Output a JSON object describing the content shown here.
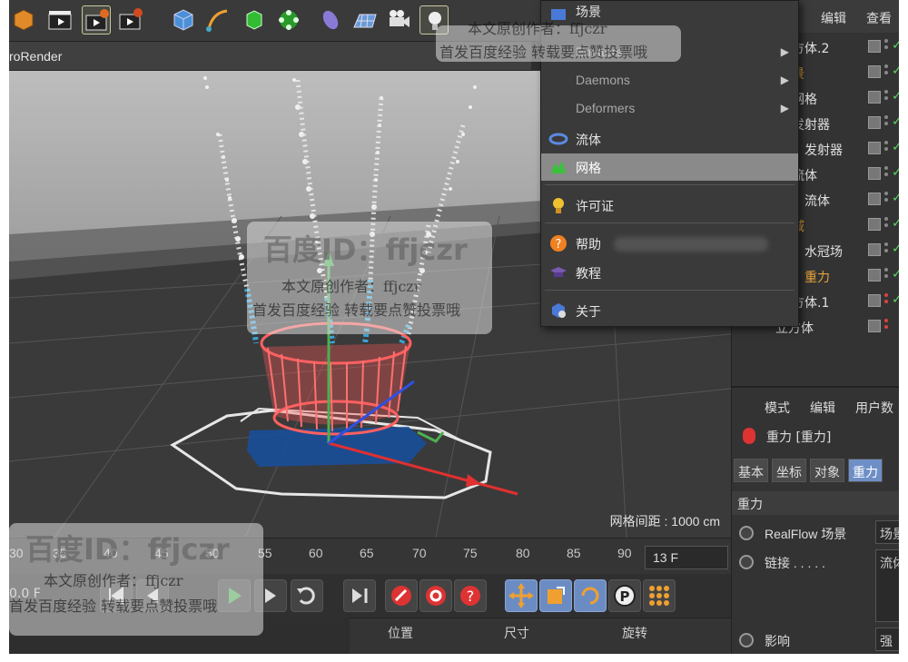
{
  "app": {
    "viewport_title": "roRender",
    "grid_distance": "网格间距 : 1000 cm"
  },
  "toolbar": {
    "icons": [
      "cube-orange-icon",
      "clapperboard-icon",
      "render-view-icon",
      "render-settings-icon",
      "cube-primitive-icon",
      "pen-spline-icon",
      "subdivision-icon",
      "array-generator-icon",
      "deformer-icon",
      "floor-icon",
      "camera-icon",
      "light-icon"
    ]
  },
  "menu": {
    "items": [
      {
        "label": "场景",
        "icon": "scene-icon"
      },
      {
        "label": "Emitters",
        "submenu": true,
        "dim": true
      },
      {
        "label": "Daemons",
        "submenu": true,
        "dim": true
      },
      {
        "label": "Deformers",
        "submenu": true,
        "dim": true
      },
      {
        "label": "流体",
        "icon": "fluid-icon"
      },
      {
        "label": "网格",
        "icon": "mesh-icon",
        "highlight": true
      },
      {
        "label": "许可证",
        "icon": "license-icon"
      },
      {
        "label": "帮助",
        "icon": "help-icon"
      },
      {
        "label": "教程",
        "icon": "tutorial-icon"
      },
      {
        "label": "关于",
        "icon": "about-icon"
      }
    ]
  },
  "object_manager": {
    "menu": [
      "编辑",
      "查看"
    ],
    "rows": [
      {
        "name": "方体.2",
        "color": "normal"
      },
      {
        "name": "景",
        "color": "orange"
      },
      {
        "name": "网格",
        "color": "normal"
      },
      {
        "name": "发射器",
        "color": "normal"
      },
      {
        "name": "发射器",
        "color": "normal"
      },
      {
        "name": "流体",
        "color": "normal"
      },
      {
        "name": "流体",
        "color": "normal"
      },
      {
        "name": "域",
        "color": "orange"
      },
      {
        "name": "水冠场",
        "color": "normal"
      },
      {
        "name": "重力",
        "color": "orange"
      },
      {
        "name": "方体.1",
        "color": "normal"
      },
      {
        "name": "立方体",
        "color": "normal"
      }
    ]
  },
  "attribute_manager": {
    "menu": [
      "模式",
      "编辑",
      "用户数"
    ],
    "title": "重力 [重力]",
    "tabs": [
      "基本",
      "坐标",
      "对象",
      "重力"
    ],
    "active_tab": "重力",
    "section": "重力",
    "params": [
      {
        "label": "RealFlow 场景",
        "value": "场景"
      },
      {
        "label": "链接 . . . . .",
        "value": "流体"
      },
      {
        "label": "影响",
        "value": "强"
      }
    ]
  },
  "timeline": {
    "ticks": [
      "30",
      "35",
      "40",
      "45",
      "50",
      "55",
      "60",
      "65",
      "70",
      "75",
      "80",
      "85",
      "90"
    ],
    "current_frame": "13 F"
  },
  "playback": {
    "start_field": "0.0 F"
  },
  "coordinates": {
    "headers": [
      "位置",
      "尺寸",
      "旋转"
    ]
  },
  "watermark": {
    "logo": "百度ID：ffjczr",
    "line1": "本文原创作者：ffjczr",
    "line2": "首发百度经验 转载要点赞投票哦"
  },
  "colors": {
    "accent_blue": "#6e8fc6",
    "highlight": "#8a8a8a",
    "orange_label": "#e8a33a",
    "particle_blue": "#3aa6d8",
    "basket_red": "#ff6060"
  }
}
